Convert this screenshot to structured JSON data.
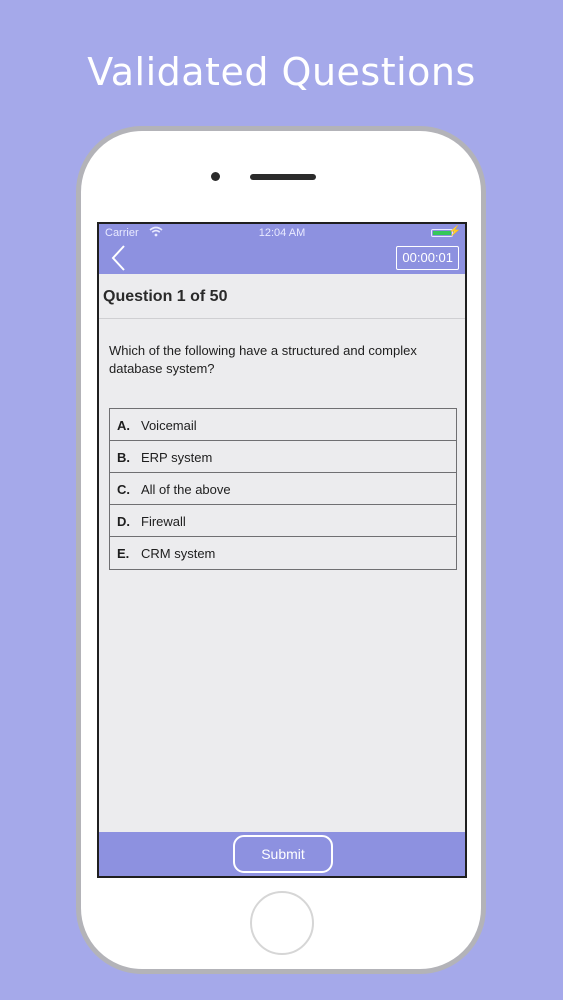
{
  "headline": "Validated Questions",
  "status_bar": {
    "carrier": "Carrier",
    "time": "12:04 AM",
    "wifi_icon": "wifi-icon",
    "battery_icon": "battery-icon",
    "battery_color": "#34c759"
  },
  "nav": {
    "back_icon": "chevron-left-icon",
    "timer": "00:00:01"
  },
  "question": {
    "header": "Question 1 of 50",
    "text": "Which of the following have a structured and complex database system?"
  },
  "answers": [
    {
      "letter": "A.",
      "text": "Voicemail"
    },
    {
      "letter": "B.",
      "text": "ERP system"
    },
    {
      "letter": "C.",
      "text": "All of the above"
    },
    {
      "letter": "D.",
      "text": "Firewall"
    },
    {
      "letter": "E.",
      "text": "CRM system"
    }
  ],
  "footer": {
    "submit_label": "Submit"
  },
  "colors": {
    "background": "#a5a9ea",
    "accent": "#8d91e0",
    "screen": "#ececee"
  }
}
